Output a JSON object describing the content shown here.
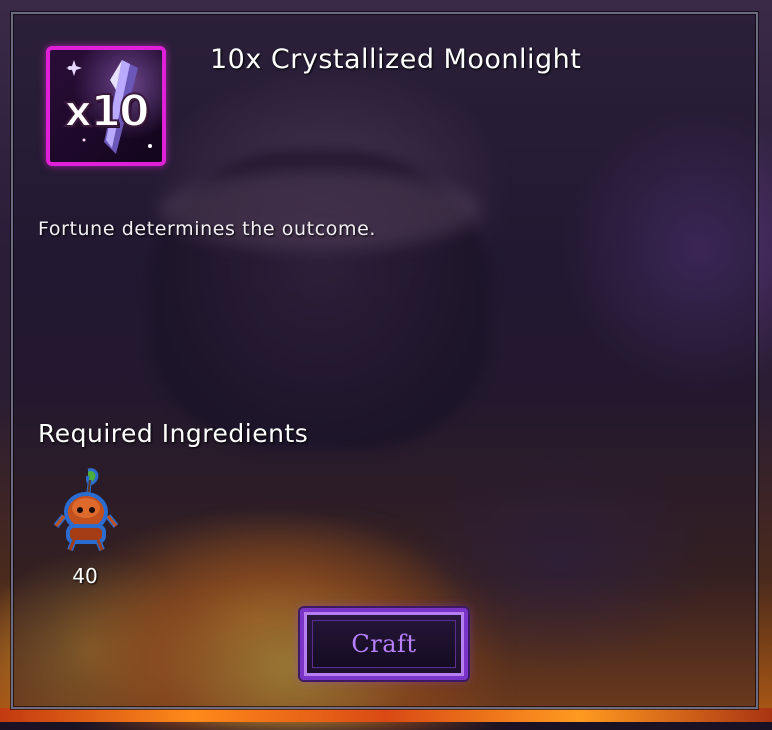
{
  "item": {
    "title": "10x Crystallized Moonlight",
    "quantity_badge": "x10",
    "icon": "crystal-shard-icon",
    "rarity_color": "#e01fd8",
    "description": "Fortune determines the outcome."
  },
  "ingredients": {
    "heading": "Required Ingredients",
    "items": [
      {
        "icon": "sprout-creature-icon",
        "count": "40"
      }
    ]
  },
  "actions": {
    "craft_label": "Craft",
    "accent_color": "#b880ff"
  }
}
